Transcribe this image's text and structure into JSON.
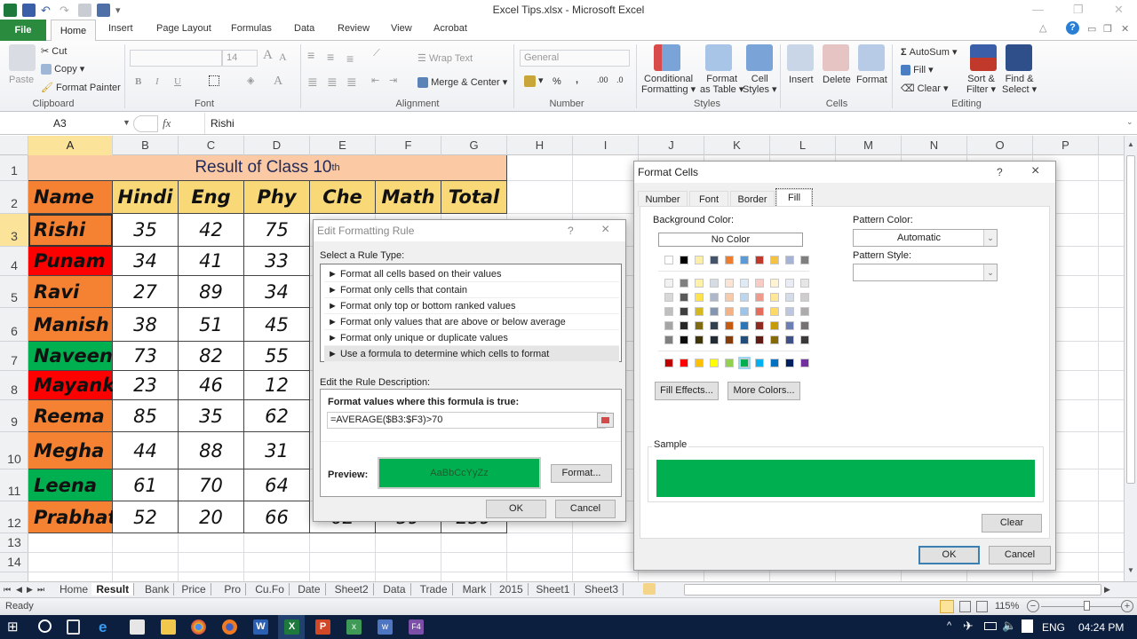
{
  "window": {
    "title": "Excel Tips.xlsx  -  Microsoft Excel",
    "controls": [
      "minimize",
      "restore",
      "close"
    ]
  },
  "ribbon_tabs": [
    "File",
    "Home",
    "Insert",
    "Page Layout",
    "Formulas",
    "Data",
    "Review",
    "View",
    "Acrobat"
  ],
  "active_ribbon_tab": "Home",
  "ribbon": {
    "clipboard": {
      "label": "Clipboard",
      "paste": "Paste",
      "cut": "Cut",
      "copy": "Copy",
      "format_painter": "Format Painter"
    },
    "font": {
      "label": "Font",
      "font_name": "",
      "font_size": "14",
      "bold": "B",
      "italic": "I",
      "underline": "U",
      "grow": "A",
      "shrink": "A",
      "font_color": "A"
    },
    "alignment": {
      "label": "Alignment",
      "wrap_text": "Wrap Text",
      "merge_center": "Merge & Center"
    },
    "number": {
      "label": "Number",
      "format": "General",
      "percent": "%",
      "comma": ",",
      "inc_decimal": ".00",
      "dec_decimal": ".0"
    },
    "styles": {
      "label": "Styles",
      "conditional_formatting": [
        "Conditional",
        "Formatting"
      ],
      "format_as_table": [
        "Format",
        "as Table"
      ],
      "cell_styles": [
        "Cell",
        "Styles"
      ]
    },
    "cells": {
      "label": "Cells",
      "insert": "Insert",
      "delete": "Delete",
      "format": "Format"
    },
    "editing": {
      "label": "Editing",
      "autosum": "AutoSum",
      "fill": "Fill",
      "clear": "Clear",
      "sort_filter": [
        "Sort &",
        "Filter"
      ],
      "find_select": [
        "Find &",
        "Select"
      ]
    }
  },
  "formula_bar": {
    "name_box": "A3",
    "fx": "fx",
    "value": "Rishi"
  },
  "columns": [
    "A",
    "B",
    "C",
    "D",
    "E",
    "F",
    "G",
    "H",
    "I",
    "J",
    "K",
    "L",
    "M",
    "N",
    "O",
    "P"
  ],
  "rows": [
    "1",
    "2",
    "3",
    "4",
    "5",
    "6",
    "7",
    "8",
    "9",
    "10",
    "11",
    "12",
    "13",
    "14"
  ],
  "selected_cell": "A3",
  "sheet": {
    "title": "Result of Class 10",
    "title_sup": "th",
    "headers": [
      "Name",
      "Hindi",
      "Eng",
      "Phy",
      "Che",
      "Math",
      "Total"
    ],
    "students": [
      {
        "name": "Rishi",
        "fill": "#f58233",
        "scores": [
          "35",
          "42",
          "75"
        ]
      },
      {
        "name": "Punam",
        "fill": "#ff0000",
        "scores": [
          "34",
          "41",
          "33"
        ]
      },
      {
        "name": "Ravi",
        "fill": "#f58233",
        "scores": [
          "27",
          "89",
          "34"
        ]
      },
      {
        "name": "Manish",
        "fill": "#f58233",
        "scores": [
          "38",
          "51",
          "45"
        ]
      },
      {
        "name": "Naveen",
        "fill": "#00b050",
        "scores": [
          "73",
          "82",
          "55"
        ]
      },
      {
        "name": "Mayank",
        "fill": "#ff0000",
        "scores": [
          "23",
          "46",
          "12"
        ]
      },
      {
        "name": "Reema",
        "fill": "#f58233",
        "scores": [
          "85",
          "35",
          "62"
        ]
      },
      {
        "name": "Megha",
        "fill": "#f58233",
        "scores": [
          "44",
          "88",
          "31"
        ]
      },
      {
        "name": "Leena",
        "fill": "#00b050",
        "scores": [
          "61",
          "70",
          "64"
        ]
      },
      {
        "name": "Prabhat",
        "fill": "#f58233",
        "scores": [
          "52",
          "20",
          "66",
          "62",
          "59",
          "259"
        ]
      }
    ],
    "colors": {
      "title_fill": "#fbcaa4",
      "header_fill": "#f9d877",
      "name_header_fill": "#f58233",
      "title_text": "#1f2a5c"
    }
  },
  "edit_rule_dialog": {
    "title": "Edit Formatting Rule",
    "help": "?",
    "close": "×",
    "select_rule_label": "Select a Rule Type:",
    "rule_types": [
      "Format all cells based on their values",
      "Format only cells that contain",
      "Format only top or bottom ranked values",
      "Format only values that are above or below average",
      "Format only unique or duplicate values",
      "Use a formula to determine which cells to format"
    ],
    "selected_rule_index": 5,
    "edit_desc_label": "Edit the Rule Description:",
    "formula_label": "Format values where this formula is true:",
    "formula": "=AVERAGE($B3:$F3)>70",
    "preview_label": "Preview:",
    "preview_text": "AaBbCcYyZz",
    "preview_color": "#00b050",
    "format_button": "Format...",
    "ok": "OK",
    "cancel": "Cancel"
  },
  "format_cells_dialog": {
    "title": "Format Cells",
    "help": "?",
    "close": "×",
    "tabs": [
      "Number",
      "Font",
      "Border",
      "Fill"
    ],
    "active_tab": "Fill",
    "background_color_label": "Background Color:",
    "no_color": "No Color",
    "theme_colors": [
      "#ffffff",
      "#000000",
      "#fbeea6",
      "#44546a",
      "#ed7d31",
      "#5b9bd5",
      "#c0392b",
      "#f5c242",
      "#a5b4d6",
      "#7f7f7f"
    ],
    "tint_rows": [
      [
        "#f2f2f2",
        "#7f7f7f",
        "#fff2a8",
        "#d6dce4",
        "#fbe4d5",
        "#deeaf6",
        "#f8cbc4",
        "#fff3d1",
        "#e9ecf5",
        "#e7e6e6"
      ],
      [
        "#d8d8d8",
        "#595959",
        "#ffe34d",
        "#adb9ca",
        "#f7caac",
        "#bdd6ee",
        "#ee9b8e",
        "#ffe699",
        "#d4dbeb",
        "#cfcdcd"
      ],
      [
        "#bfbfbf",
        "#3f3f3f",
        "#d5b820",
        "#8496b0",
        "#f4b183",
        "#9dc3e6",
        "#e56b5a",
        "#ffd966",
        "#bdc7e0",
        "#aeabab"
      ],
      [
        "#a5a5a5",
        "#262626",
        "#7f6b12",
        "#323f4f",
        "#c55a11",
        "#2e75b5",
        "#8e2a1f",
        "#c59b0a",
        "#6b7fb4",
        "#757171"
      ],
      [
        "#7f7f7f",
        "#0c0c0c",
        "#3f350a",
        "#222a35",
        "#843c0b",
        "#1f4e79",
        "#5e1c14",
        "#866a06",
        "#3f5184",
        "#3a3838"
      ]
    ],
    "standard_colors": [
      "#c00000",
      "#ff0000",
      "#ffc000",
      "#ffff00",
      "#92d050",
      "#00b050",
      "#00b0f0",
      "#0070c0",
      "#002060",
      "#7030a0"
    ],
    "selected_standard_index": 5,
    "fill_effects": "Fill Effects...",
    "more_colors": "More Colors...",
    "pattern_color_label": "Pattern Color:",
    "pattern_color_value": "Automatic",
    "pattern_style_label": "Pattern Style:",
    "pattern_style_value": "",
    "sample_label": "Sample",
    "sample_color": "#00b050",
    "clear": "Clear",
    "ok": "OK",
    "cancel": "Cancel"
  },
  "sheet_tabs": [
    "Home",
    "Result",
    "Bank",
    "Price",
    "Pro",
    "Cu.Fo",
    "Date",
    "Sheet2",
    "Data",
    "Trade",
    "Mark",
    "2015",
    "Sheet1",
    "Sheet3"
  ],
  "active_sheet": "Result",
  "status_bar": {
    "status": "Ready",
    "zoom": "115%",
    "zoom_fraction": 0.57
  },
  "taskbar": {
    "apps": [
      "start",
      "search",
      "task-view",
      "edge",
      "store",
      "file-explorer",
      "chrome",
      "firefox",
      "word",
      "excel",
      "powerpoint",
      "excel-2",
      "word-2",
      "app-f4"
    ],
    "language": "ENG",
    "time": "04:24 PM"
  }
}
